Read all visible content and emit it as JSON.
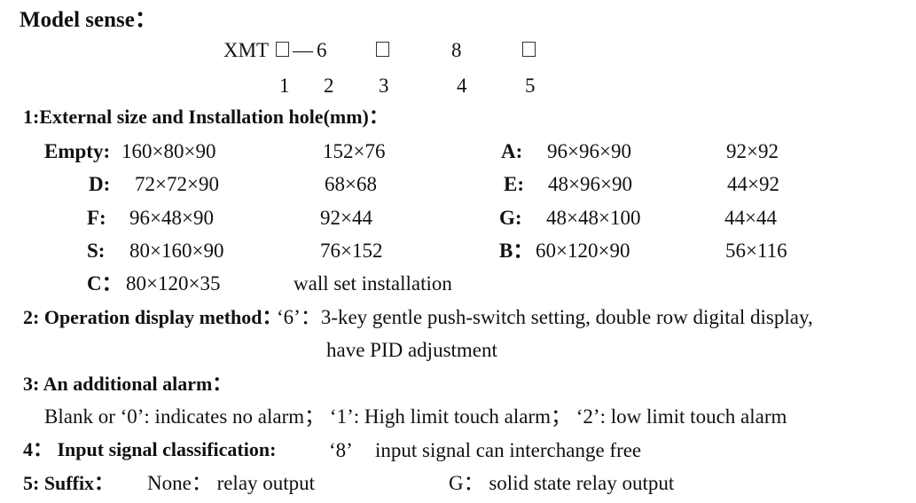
{
  "title": "Model sense：",
  "model": {
    "prefix": "XMT",
    "dash": "—",
    "code2": "6",
    "code4": "8",
    "positions": [
      "1",
      "2",
      "3",
      "4",
      "5"
    ]
  },
  "section1": {
    "heading": "1:External size and Installation hole(mm)：",
    "rows": [
      {
        "label": "Empty:",
        "size": "160×80×90",
        "hole": "152×76"
      },
      {
        "label": "D:",
        "size": "72×72×90",
        "hole": "68×68"
      },
      {
        "label": "F:",
        "size": "96×48×90",
        "hole": "92×44"
      },
      {
        "label": "S:",
        "size": "80×160×90",
        "hole": "76×152"
      },
      {
        "label": "C：",
        "size": "80×120×35",
        "hole": "wall set installation"
      },
      {
        "label": "A:",
        "size": "96×96×90",
        "hole": "92×92"
      },
      {
        "label": "E:",
        "size": "48×96×90",
        "hole": "44×92"
      },
      {
        "label": "G:",
        "size": "48×48×100",
        "hole": "44×44"
      },
      {
        "label": "B：",
        "size": "60×120×90",
        "hole": "56×116"
      }
    ]
  },
  "section2": {
    "heading": "2: Operation display method：",
    "text_line1": "‘6’：3-key gentle push-switch setting, double row digital display,",
    "text_line2": "have PID adjustment"
  },
  "section3": {
    "heading": "3: An additional alarm：",
    "text": "Blank or ‘0’: indicates no alarm； ‘1’: High limit touch alarm； ‘2’: low limit touch alarm"
  },
  "section4": {
    "heading": "4： Input signal classification:",
    "code": "‘8’",
    "text": "input signal can interchange free"
  },
  "section5": {
    "heading": "5: Suffix：",
    "option1": "None： relay output",
    "option2": "G： solid state relay output"
  }
}
